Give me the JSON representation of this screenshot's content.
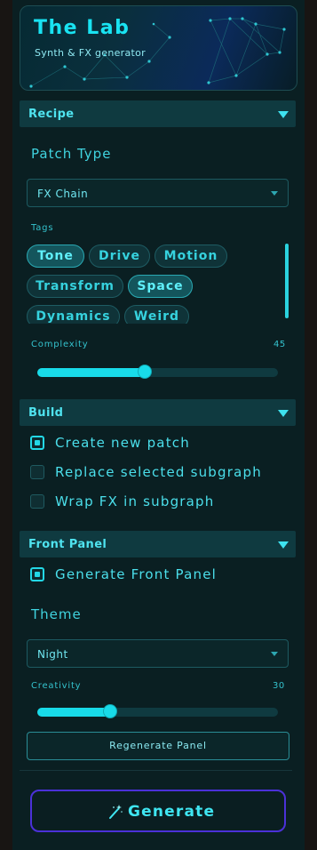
{
  "header": {
    "title": "The Lab",
    "subtitle": "Synth & FX generator"
  },
  "recipe": {
    "section_label": "Recipe",
    "patch_type_label": "Patch Type",
    "patch_type_value": "FX Chain",
    "tags_label": "Tags",
    "tags": [
      {
        "label": "Tone",
        "active": true
      },
      {
        "label": "Drive",
        "active": false
      },
      {
        "label": "Motion",
        "active": false
      },
      {
        "label": "Transform",
        "active": false
      },
      {
        "label": "Space",
        "active": true
      },
      {
        "label": "Dynamics",
        "active": false
      },
      {
        "label": "Weird",
        "active": false
      }
    ],
    "complexity_label": "Complexity",
    "complexity_value": "45"
  },
  "build": {
    "section_label": "Build",
    "options": [
      {
        "label": "Create new patch",
        "checked": true
      },
      {
        "label": "Replace selected subgraph",
        "checked": false
      },
      {
        "label": "Wrap FX in subgraph",
        "checked": false
      }
    ]
  },
  "front_panel": {
    "section_label": "Front Panel",
    "generate_label": "Generate Front Panel",
    "generate_checked": true,
    "theme_label": "Theme",
    "theme_value": "Night",
    "creativity_label": "Creativity",
    "creativity_value": "30",
    "regenerate_label": "Regenerate Panel"
  },
  "actions": {
    "generate_label": "Generate"
  },
  "colors": {
    "accent": "#18dbe9",
    "generate_border": "#4b31d8",
    "panel_bg": "#0a1f22"
  }
}
